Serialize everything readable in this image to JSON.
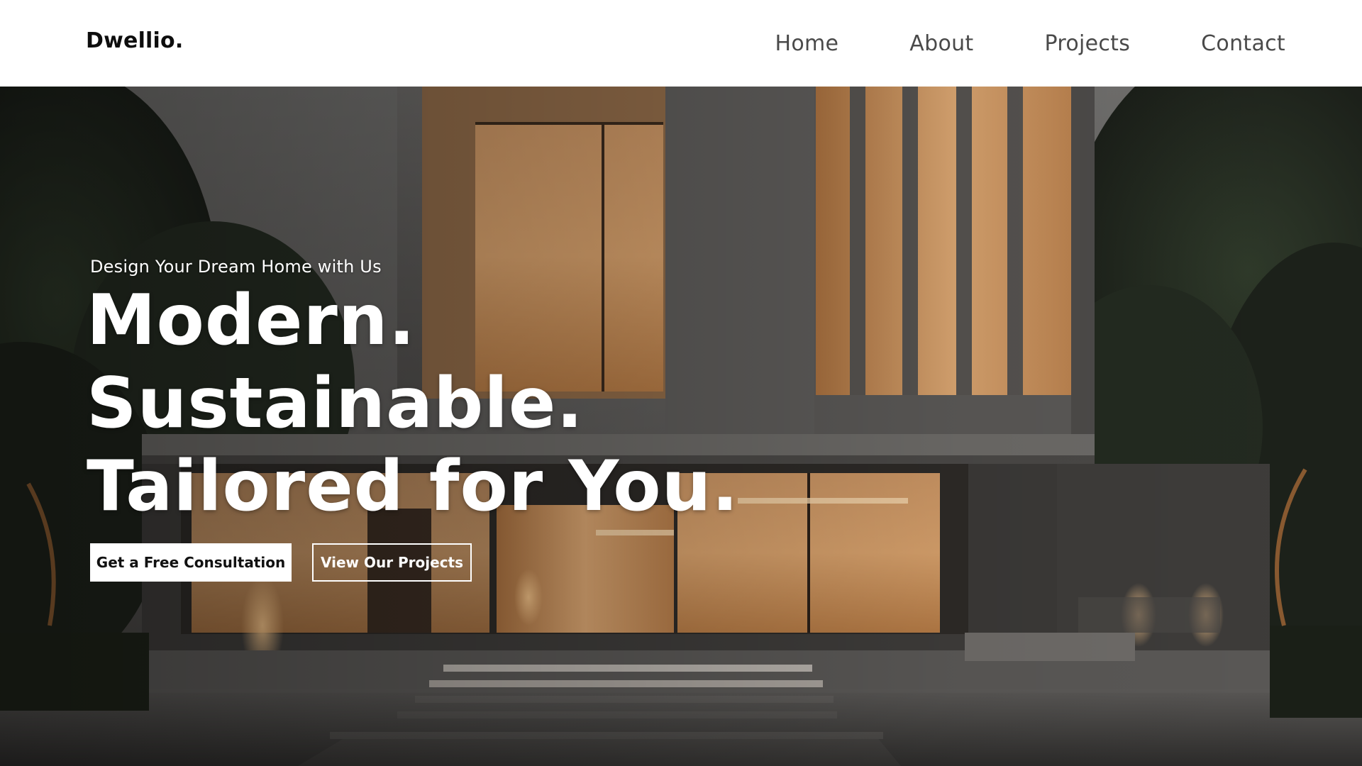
{
  "brand": {
    "logo_text": "Dwellio."
  },
  "nav": {
    "items": [
      {
        "label": "Home"
      },
      {
        "label": "About"
      },
      {
        "label": "Projects"
      },
      {
        "label": "Contact"
      }
    ]
  },
  "hero": {
    "eyebrow": "Design Your Dream Home with Us",
    "headline_lines": [
      "Modern.",
      "Sustainable.",
      "Tailored for You."
    ],
    "primary_cta": "Get a Free Consultation",
    "secondary_cta": "View Our Projects",
    "background_image": "modern-house-night-photo"
  },
  "colors": {
    "nav_bg": "#ffffff",
    "logo": "#0d0d0d",
    "nav_text": "#4a4a4a",
    "headline": "#ffffff",
    "primary_button_bg": "#ffffff",
    "primary_button_text": "#111111",
    "warm_light": "#d79a5a"
  }
}
